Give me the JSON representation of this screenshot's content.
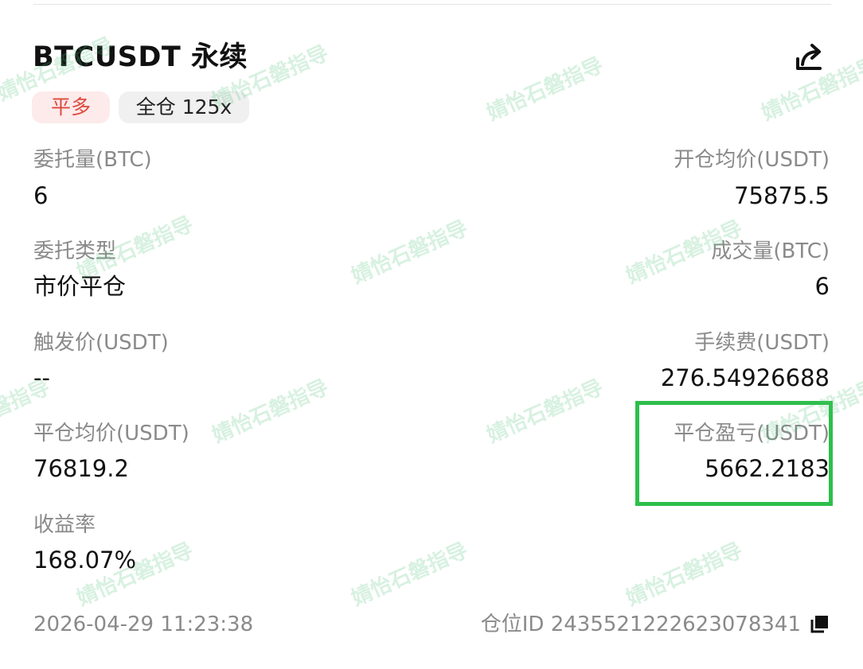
{
  "header": {
    "symbol": "BTCUSDT",
    "contract_type": "永续",
    "side_badge": "平多",
    "margin_mode": "全仓",
    "leverage": "125x"
  },
  "fields": {
    "order_qty": {
      "label": "委托量(BTC)",
      "value": "6"
    },
    "open_avg_price": {
      "label": "开仓均价(USDT)",
      "value": "75875.5"
    },
    "order_type": {
      "label": "委托类型",
      "value": "市价平仓"
    },
    "filled_qty": {
      "label": "成交量(BTC)",
      "value": "6"
    },
    "trigger_price": {
      "label": "触发价(USDT)",
      "value": "--"
    },
    "fee": {
      "label": "手续费(USDT)",
      "value": "276.54926688"
    },
    "close_avg_price": {
      "label": "平仓均价(USDT)",
      "value": "76819.2"
    },
    "close_pnl": {
      "label": "平仓盈亏(USDT)",
      "value": "5662.2183"
    },
    "roi": {
      "label": "收益率",
      "value": "168.07%"
    }
  },
  "footer": {
    "timestamp": "2026-04-29 11:23:38",
    "position_id_label": "仓位ID",
    "position_id": "2435521222623078341"
  },
  "watermark": "婧怡石磐指导",
  "colors": {
    "side_badge_text": "#de4a3e",
    "side_badge_bg": "#fdeaea",
    "highlight_border": "#2dbf4b",
    "label_gray": "#8a8a8a"
  },
  "icons": {
    "share": "share-icon",
    "copy": "copy-icon"
  }
}
